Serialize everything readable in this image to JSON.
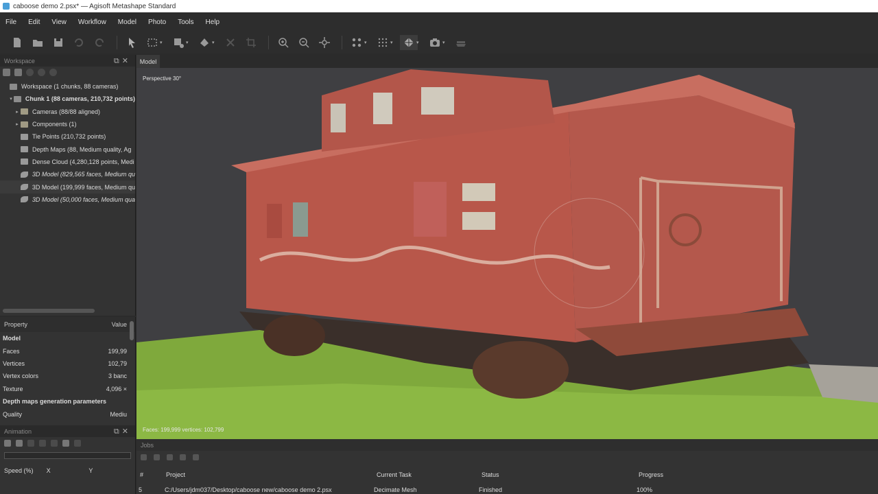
{
  "window": {
    "title": "caboose demo 2.psx* — Agisoft Metashape Standard"
  },
  "menu": [
    "File",
    "Edit",
    "View",
    "Workflow",
    "Model",
    "Photo",
    "Tools",
    "Help"
  ],
  "workspace": {
    "panel_title": "Workspace",
    "tree": [
      {
        "label": "Workspace (1 chunks, 88 cameras)",
        "style": "normal",
        "indent": 0,
        "arrow": ""
      },
      {
        "label": "Chunk 1 (88 cameras, 210,732 points)",
        "style": "bold",
        "indent": 1,
        "arrow": "▾"
      },
      {
        "label": "Cameras (88/88 aligned)",
        "style": "normal",
        "indent": 2,
        "arrow": "▸"
      },
      {
        "label": "Components (1)",
        "style": "normal",
        "indent": 2,
        "arrow": "▸"
      },
      {
        "label": "Tie Points (210,732 points)",
        "style": "normal",
        "indent": 2,
        "arrow": ""
      },
      {
        "label": "Depth Maps (88, Medium quality, Ag",
        "style": "normal",
        "indent": 2,
        "arrow": ""
      },
      {
        "label": "Dense Cloud (4,280,128 points, Medi",
        "style": "normal",
        "indent": 2,
        "arrow": ""
      },
      {
        "label": "3D Model (829,565 faces, Medium qu",
        "style": "italic",
        "indent": 2,
        "arrow": ""
      },
      {
        "label": "3D Model (199,999 faces, Medium qu",
        "style": "normal",
        "indent": 2,
        "arrow": ""
      },
      {
        "label": "3D Model (50,000 faces, Medium qua",
        "style": "italic",
        "indent": 2,
        "arrow": ""
      }
    ]
  },
  "properties": {
    "col_property": "Property",
    "col_value": "Value",
    "rows": [
      {
        "name": "Model",
        "value": "",
        "group": true
      },
      {
        "name": "Faces",
        "value": "199,99",
        "group": false
      },
      {
        "name": "Vertices",
        "value": "102,79",
        "group": false
      },
      {
        "name": "Vertex colors",
        "value": "3 banc",
        "group": false
      },
      {
        "name": "Texture",
        "value": "4,096 ×",
        "group": false
      },
      {
        "name": "Depth maps generation parameters",
        "value": "",
        "group": true
      },
      {
        "name": "Quality",
        "value": "Mediu",
        "group": false
      }
    ]
  },
  "animation": {
    "panel_title": "Animation",
    "col_speed": "Speed (%)",
    "col_x": "X",
    "col_y": "Y"
  },
  "model_view": {
    "tab_label": "Model",
    "perspective_label": "Perspective 30°",
    "stats_label": "Faces: 199,999 vertices: 102,799",
    "colors": {
      "background": "#3f3f42",
      "car_body": "#b8574a",
      "grass": "#7fa93c"
    }
  },
  "jobs": {
    "panel_title": "Jobs",
    "columns": {
      "num": "#",
      "project": "Project",
      "task": "Current Task",
      "status": "Status",
      "progress": "Progress"
    },
    "rows": [
      {
        "num": "5",
        "project": "C:/Users/jdm037/Desktop/caboose new/caboose demo 2.psx",
        "task": "Decimate Mesh",
        "status": "Finished",
        "progress": "100%"
      }
    ]
  }
}
